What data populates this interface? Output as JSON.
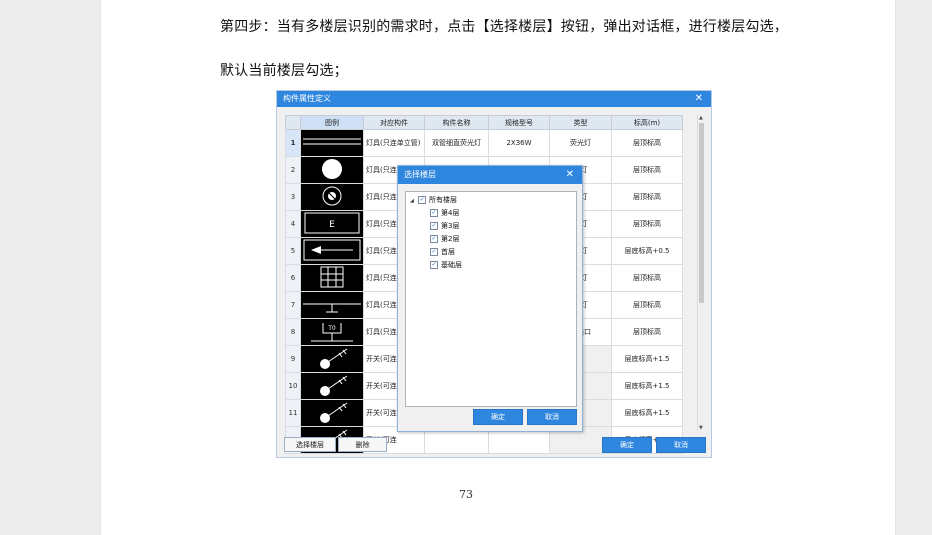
{
  "document": {
    "paragraph_1": "第四步：当有多楼层识别的需求时，点击【选择楼层】按钮，弹出对话框，进行楼层勾选，",
    "paragraph_2": "默认当前楼层勾选；",
    "page_number": "73"
  },
  "main_dialog": {
    "title": "构件属性定义",
    "close_glyph": "✕",
    "columns": [
      "图例",
      "对应构件",
      "构件名称",
      "规格型号",
      "类型",
      "标高(m)"
    ],
    "rows": [
      {
        "num": "1",
        "component": "灯具(只连单立管)",
        "name": "双管细直荧光灯",
        "spec": "2X36W",
        "type": "荧光灯",
        "elev": "层顶标高",
        "legend": "double-line"
      },
      {
        "num": "2",
        "component": "灯具(只连",
        "name": "",
        "spec": "",
        "type": "光灯",
        "elev": "层顶标高",
        "legend": "filled-circle"
      },
      {
        "num": "3",
        "component": "灯具(只连",
        "name": "",
        "spec": "",
        "type": "光灯",
        "elev": "层顶标高",
        "legend": "ring-circle"
      },
      {
        "num": "4",
        "component": "灯具(只连",
        "name": "",
        "spec": "",
        "type": "光灯",
        "elev": "层顶标高",
        "legend": "box-e",
        "legend_text": "E"
      },
      {
        "num": "5",
        "component": "灯具(只连",
        "name": "",
        "spec": "",
        "type": "光灯",
        "elev": "层底标高+0.5",
        "legend": "arrow-box"
      },
      {
        "num": "6",
        "component": "灯具(只连",
        "name": "",
        "spec": "",
        "type": "光灯",
        "elev": "层顶标高",
        "legend": "grid-box"
      },
      {
        "num": "7",
        "component": "灯具(只连",
        "name": "",
        "spec": "",
        "type": "光灯",
        "elev": "层顶标高",
        "legend": "t-line"
      },
      {
        "num": "8",
        "component": "灯具(只连",
        "name": "",
        "spec": "",
        "type": "出线口",
        "elev": "层顶标高",
        "legend": "t0-box",
        "legend_text": "T0"
      },
      {
        "num": "9",
        "component": "开关(可连",
        "name": "",
        "spec": "",
        "type": "",
        "elev": "层底标高+1.5",
        "legend": "switch"
      },
      {
        "num": "10",
        "component": "开关(可连",
        "name": "",
        "spec": "",
        "type": "",
        "elev": "层底标高+1.5",
        "legend": "switch"
      },
      {
        "num": "11",
        "component": "开关(可连",
        "name": "",
        "spec": "",
        "type": "",
        "elev": "层底标高+1.5",
        "legend": "switch"
      },
      {
        "num": "12",
        "component": "开关(可连",
        "name": "",
        "spec": "",
        "type": "",
        "elev": "层底标高+1.5",
        "legend": "switch"
      }
    ],
    "buttons": {
      "select_floor": "选择楼层",
      "delete": "删除",
      "ok": "确定",
      "cancel": "取消"
    }
  },
  "floor_dialog": {
    "title": "选择楼层",
    "close_glyph": "✕",
    "root": {
      "label": "所有楼层",
      "checked": true,
      "expander": "◢"
    },
    "floors": [
      {
        "label": "第4层",
        "checked": true
      },
      {
        "label": "第3层",
        "checked": true
      },
      {
        "label": "第2层",
        "checked": true
      },
      {
        "label": "首层",
        "checked": true
      },
      {
        "label": "基础层",
        "checked": true
      }
    ],
    "ok": "确定",
    "cancel": "取消",
    "check_glyph": "✓"
  },
  "colors": {
    "title_bar": "#2f86df",
    "legend_bg": "#000000"
  }
}
